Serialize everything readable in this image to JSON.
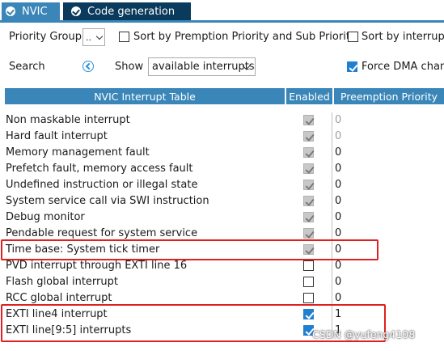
{
  "tabs": [
    {
      "label": "NVIC",
      "icon": "check-circle-icon"
    },
    {
      "label": "Code generation",
      "icon": "check-circle-icon"
    }
  ],
  "controls": {
    "priority_group_label": "Priority Group",
    "priority_group_value": "..",
    "sort_by_preemption_label": "Sort by Premption Priority and Sub Priority",
    "sort_by_interrupts_label": "Sort by interrupts",
    "search_label": "Search",
    "show_label": "Show",
    "show_value": "available interrupts",
    "force_dma_label": "Force DMA chan"
  },
  "table": {
    "headers": [
      "NVIC Interrupt Table",
      "Enabled",
      "Preemption Priority"
    ],
    "rows": [
      {
        "name": "Non maskable interrupt",
        "enabled": "checked-disabled",
        "priority": "0",
        "priority_editable": false
      },
      {
        "name": "Hard fault interrupt",
        "enabled": "checked-disabled",
        "priority": "0",
        "priority_editable": false
      },
      {
        "name": "Memory management fault",
        "enabled": "checked-disabled",
        "priority": "0",
        "priority_editable": true
      },
      {
        "name": "Prefetch fault, memory access fault",
        "enabled": "checked-disabled",
        "priority": "0",
        "priority_editable": true
      },
      {
        "name": "Undefined instruction or illegal state",
        "enabled": "checked-disabled",
        "priority": "0",
        "priority_editable": true
      },
      {
        "name": "System service call via SWI instruction",
        "enabled": "checked-disabled",
        "priority": "0",
        "priority_editable": true
      },
      {
        "name": "Debug monitor",
        "enabled": "checked-disabled",
        "priority": "0",
        "priority_editable": true
      },
      {
        "name": "Pendable request for system service",
        "enabled": "checked-disabled",
        "priority": "0",
        "priority_editable": true
      },
      {
        "name": "Time base: System tick timer",
        "enabled": "checked-disabled",
        "priority": "0",
        "priority_editable": true
      },
      {
        "name": "PVD interrupt through EXTI line 16",
        "enabled": "unchecked",
        "priority": "0",
        "priority_editable": true
      },
      {
        "name": "Flash global interrupt",
        "enabled": "unchecked",
        "priority": "0",
        "priority_editable": true
      },
      {
        "name": "RCC global interrupt",
        "enabled": "unchecked",
        "priority": "0",
        "priority_editable": true
      },
      {
        "name": "EXTI line4 interrupt",
        "enabled": "checked",
        "priority": "1",
        "priority_editable": true
      },
      {
        "name": "EXTI line[9:5] interrupts",
        "enabled": "checked",
        "priority": "1",
        "priority_editable": true
      }
    ]
  },
  "watermark": "CSDN @yufeng4108",
  "colors": {
    "tab_active": "#3a86b8",
    "tab_inactive": "#0a3a5c",
    "header_bg": "#3a86b8",
    "highlight": "#e02020",
    "checkbox_on": "#1f7fd1"
  }
}
